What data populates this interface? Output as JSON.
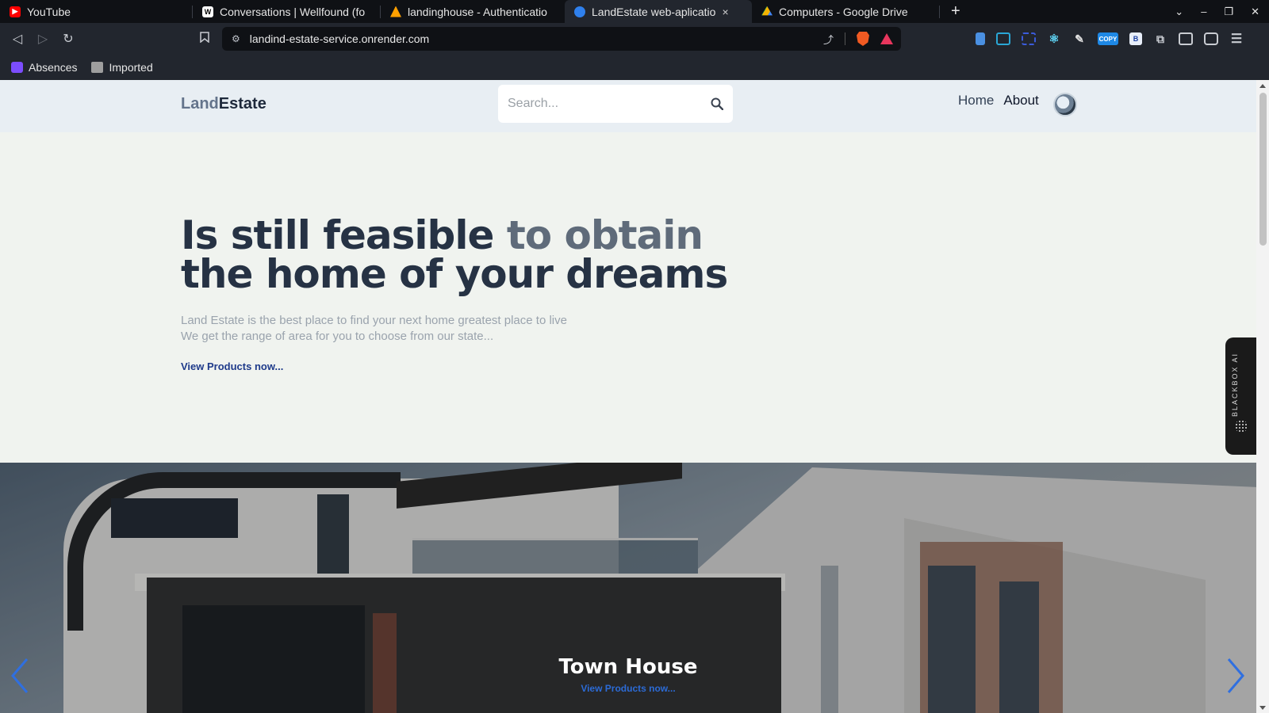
{
  "browser": {
    "tabs": [
      {
        "title": "YouTube",
        "icon": "youtube-icon",
        "color": "#ff0000",
        "active": false
      },
      {
        "title": "Conversations | Wellfound (fo",
        "icon": "wellfound-icon",
        "color": "#ffffff",
        "active": false
      },
      {
        "title": "landinghouse - Authenticatio",
        "icon": "firebase-icon",
        "color": "#ffa000",
        "active": false
      },
      {
        "title": "LandEstate web-aplicatio",
        "icon": "site-favicon",
        "color": "#2f80ed",
        "active": true
      },
      {
        "title": "Computers - Google Drive",
        "icon": "google-drive-icon",
        "color": "#0f9d58",
        "active": false
      }
    ],
    "active_tab_close": "×",
    "new_tab": "+",
    "url": "landind-estate-service.onrender.com",
    "bookmarks": [
      {
        "label": "Absences",
        "icon": "absences-app-icon",
        "color": "#7c4dff"
      },
      {
        "label": "Imported",
        "icon": "folder-icon",
        "color": "#9e9e9e"
      }
    ],
    "extensions": [
      "file-icon",
      "screenshot-icon",
      "capture-icon",
      "react-devtools-icon",
      "color-picker-icon",
      "copy-extension-icon",
      "b-extension-icon",
      "puzzle-icon",
      "sidebar-icon",
      "wallet-icon",
      "menu-icon"
    ],
    "copy_badge": "COPY",
    "b_badge": "B"
  },
  "site": {
    "logo_part1": "Land",
    "logo_part2": "Estate",
    "search_placeholder": "Search...",
    "nav": {
      "home": "Home",
      "about": "About"
    },
    "hero": {
      "headline_part1": "Is still feasible ",
      "headline_part2": "to obtain",
      "headline_line2": "the home of your dreams",
      "sub_line1": "Land Estate is the best place to find your next home greatest place to live",
      "sub_line2": "We get the range of area for you to choose from our state...",
      "cta": "View Products now..."
    },
    "carousel": {
      "slide_title": "Town House",
      "slide_link": "View Products now..."
    }
  },
  "widget": {
    "label": "BLACKBOX AI"
  }
}
